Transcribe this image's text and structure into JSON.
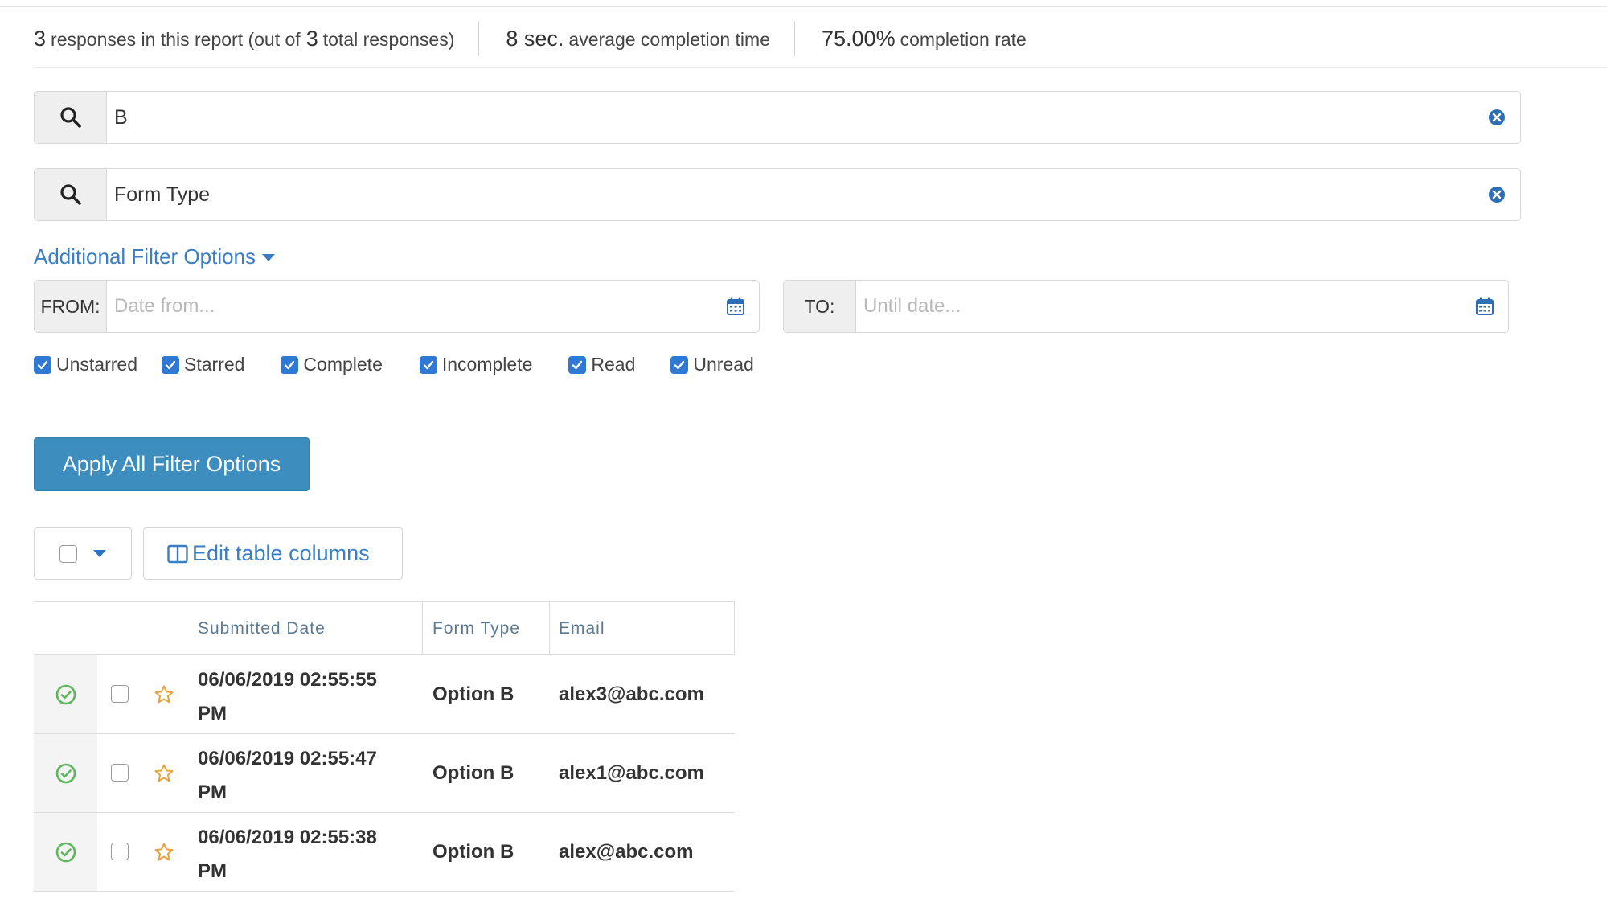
{
  "stats": {
    "responses_count": "3",
    "responses_label": "responses in this report (out of",
    "total_count": "3",
    "total_label": "total responses)",
    "avg_time": "8 sec.",
    "avg_time_label": "average completion time",
    "rate": "75.00%",
    "rate_label": "completion rate"
  },
  "search": [
    {
      "value": "B",
      "icon": "search-icon",
      "clear_icon": "clear-circle-icon"
    },
    {
      "value": "Form Type",
      "icon": "search-icon",
      "clear_icon": "clear-circle-icon"
    }
  ],
  "filters": {
    "toggle_label": "Additional Filter Options",
    "from_label": "FROM:",
    "from_placeholder": "Date from...",
    "to_label": "TO:",
    "to_placeholder": "Until date...",
    "checkboxes": [
      {
        "label": "Unstarred",
        "checked": true
      },
      {
        "label": "Starred",
        "checked": true
      },
      {
        "label": "Complete",
        "checked": true
      },
      {
        "label": "Incomplete",
        "checked": true
      },
      {
        "label": "Read",
        "checked": true
      },
      {
        "label": "Unread",
        "checked": true
      }
    ],
    "apply_label": "Apply All Filter Options"
  },
  "toolbar": {
    "edit_columns_label": "Edit table columns"
  },
  "table": {
    "columns": [
      "Submitted Date",
      "Form Type",
      "Email"
    ],
    "rows": [
      {
        "date_line1": "06/06/2019 02:55:55",
        "date_line2": "PM",
        "form_type": "Option B",
        "email": "alex3@abc.com",
        "status": "complete",
        "starred": false
      },
      {
        "date_line1": "06/06/2019 02:55:47",
        "date_line2": "PM",
        "form_type": "Option B",
        "email": "alex1@abc.com",
        "status": "complete",
        "starred": false
      },
      {
        "date_line1": "06/06/2019 02:55:38",
        "date_line2": "PM",
        "form_type": "Option B",
        "email": "alex@abc.com",
        "status": "complete",
        "starred": false
      }
    ]
  },
  "colors": {
    "accent": "#3b7ec2",
    "button": "#3d8ebf",
    "checkbox": "#2f78d4",
    "status_ok": "#5cb85c",
    "star": "#e8a33d"
  }
}
